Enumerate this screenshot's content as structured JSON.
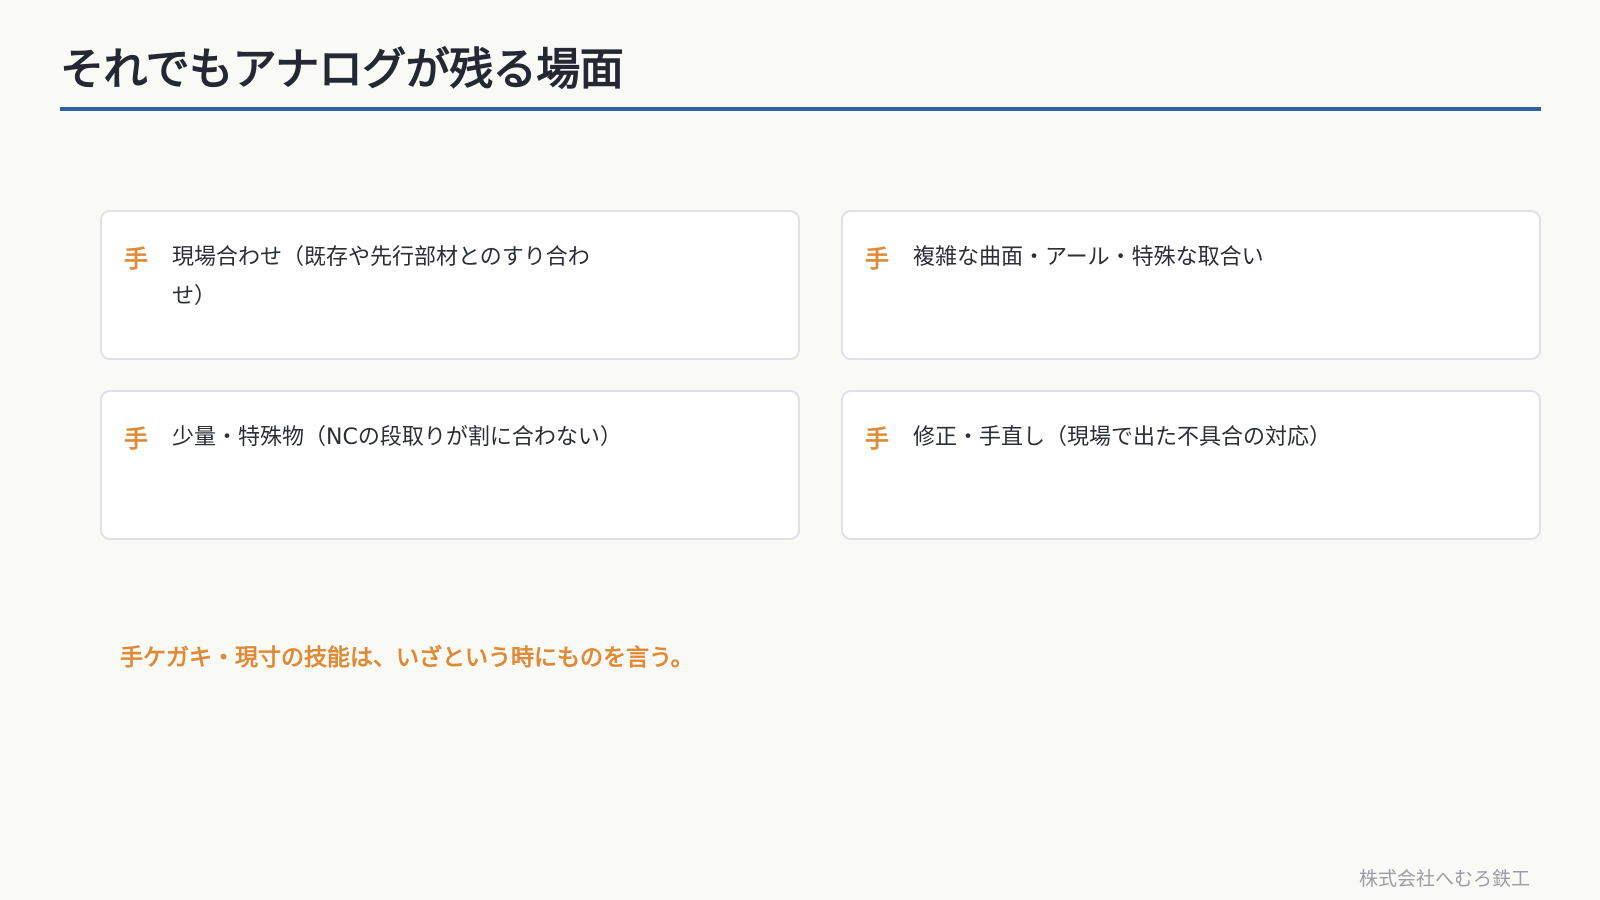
{
  "title": "それでもアナログが残る場面",
  "colors": {
    "accent": "#e08a36",
    "rule": "#2d62a2",
    "title": "#232832",
    "background": "#f9f9f6",
    "card_border": "#dfe1e6"
  },
  "cards": [
    {
      "icon_label": "手",
      "text": "現場合わせ（既存や先行部材とのすり合わせ）"
    },
    {
      "icon_label": "手",
      "text": "複雑な曲面・アール・特殊な取合い"
    },
    {
      "icon_label": "手",
      "text": "少量・特殊物（NCの段取りが割に合わない）"
    },
    {
      "icon_label": "手",
      "text": "修正・手直し（現場で出た不具合の対応）"
    }
  ],
  "tagline": "手ケガキ・現寸の技能は、いざという時にものを言う。",
  "footer": "株式会社へむろ鉄工"
}
